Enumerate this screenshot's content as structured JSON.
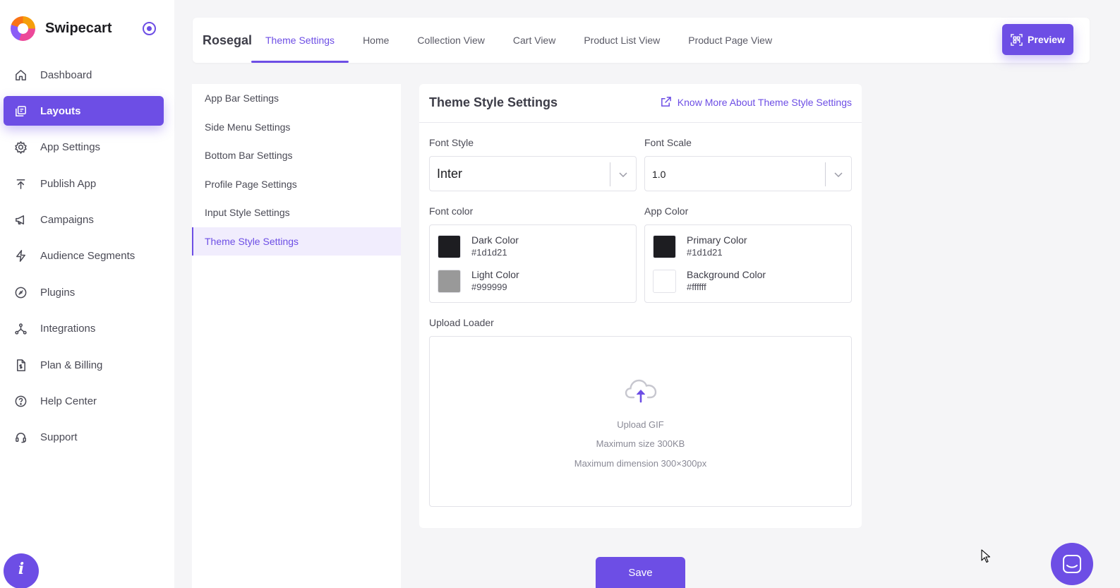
{
  "brand": {
    "name": "Swipecart"
  },
  "sidebar": {
    "items": [
      {
        "label": "Dashboard",
        "icon": "home-icon",
        "active": false
      },
      {
        "label": "Layouts",
        "icon": "layouts-icon",
        "active": true
      },
      {
        "label": "App Settings",
        "icon": "gear-icon",
        "active": false
      },
      {
        "label": "Publish App",
        "icon": "publish-icon",
        "active": false
      },
      {
        "label": "Campaigns",
        "icon": "megaphone-icon",
        "active": false
      },
      {
        "label": "Audience Segments",
        "icon": "lightning-icon",
        "active": false
      },
      {
        "label": "Plugins",
        "icon": "plugin-icon",
        "active": false
      },
      {
        "label": "Integrations",
        "icon": "integrations-icon",
        "active": false
      },
      {
        "label": "Plan & Billing",
        "icon": "billing-icon",
        "active": false
      },
      {
        "label": "Help Center",
        "icon": "help-icon",
        "active": false
      },
      {
        "label": "Support",
        "icon": "headset-icon",
        "active": false
      }
    ],
    "info_glyph": "i"
  },
  "topbar": {
    "store_name": "Rosegal",
    "tabs": [
      {
        "label": "Theme Settings",
        "active": true
      },
      {
        "label": "Home",
        "active": false
      },
      {
        "label": "Collection View",
        "active": false
      },
      {
        "label": "Cart View",
        "active": false
      },
      {
        "label": "Product List View",
        "active": false
      },
      {
        "label": "Product Page View",
        "active": false
      }
    ],
    "preview_label": "Preview"
  },
  "settings_menu": {
    "items": [
      {
        "label": "App Bar Settings",
        "active": false
      },
      {
        "label": "Side Menu Settings",
        "active": false
      },
      {
        "label": "Bottom Bar Settings",
        "active": false
      },
      {
        "label": "Profile Page Settings",
        "active": false
      },
      {
        "label": "Input Style Settings",
        "active": false
      },
      {
        "label": "Theme Style Settings",
        "active": true
      }
    ]
  },
  "card": {
    "title": "Theme Style Settings",
    "know_more": "Know More About Theme Style Settings",
    "font_style": {
      "label": "Font Style",
      "value": "Inter"
    },
    "font_scale": {
      "label": "Font Scale",
      "value": "1.0"
    },
    "font_color": {
      "label": "Font color",
      "dark": {
        "name": "Dark Color",
        "hex": "#1d1d21"
      },
      "light": {
        "name": "Light Color",
        "hex": "#999999"
      }
    },
    "app_color": {
      "label": "App Color",
      "primary": {
        "name": "Primary Color",
        "hex": "#1d1d21"
      },
      "background": {
        "name": "Background Color",
        "hex": "#ffffff"
      }
    },
    "upload": {
      "label": "Upload Loader",
      "line1": "Upload GIF",
      "line2": "Maximum size 300KB",
      "line3": "Maximum dimension 300×300px"
    }
  },
  "save_label": "Save",
  "colors": {
    "accent": "#6d4ee5",
    "background": "#f5f5f7"
  }
}
